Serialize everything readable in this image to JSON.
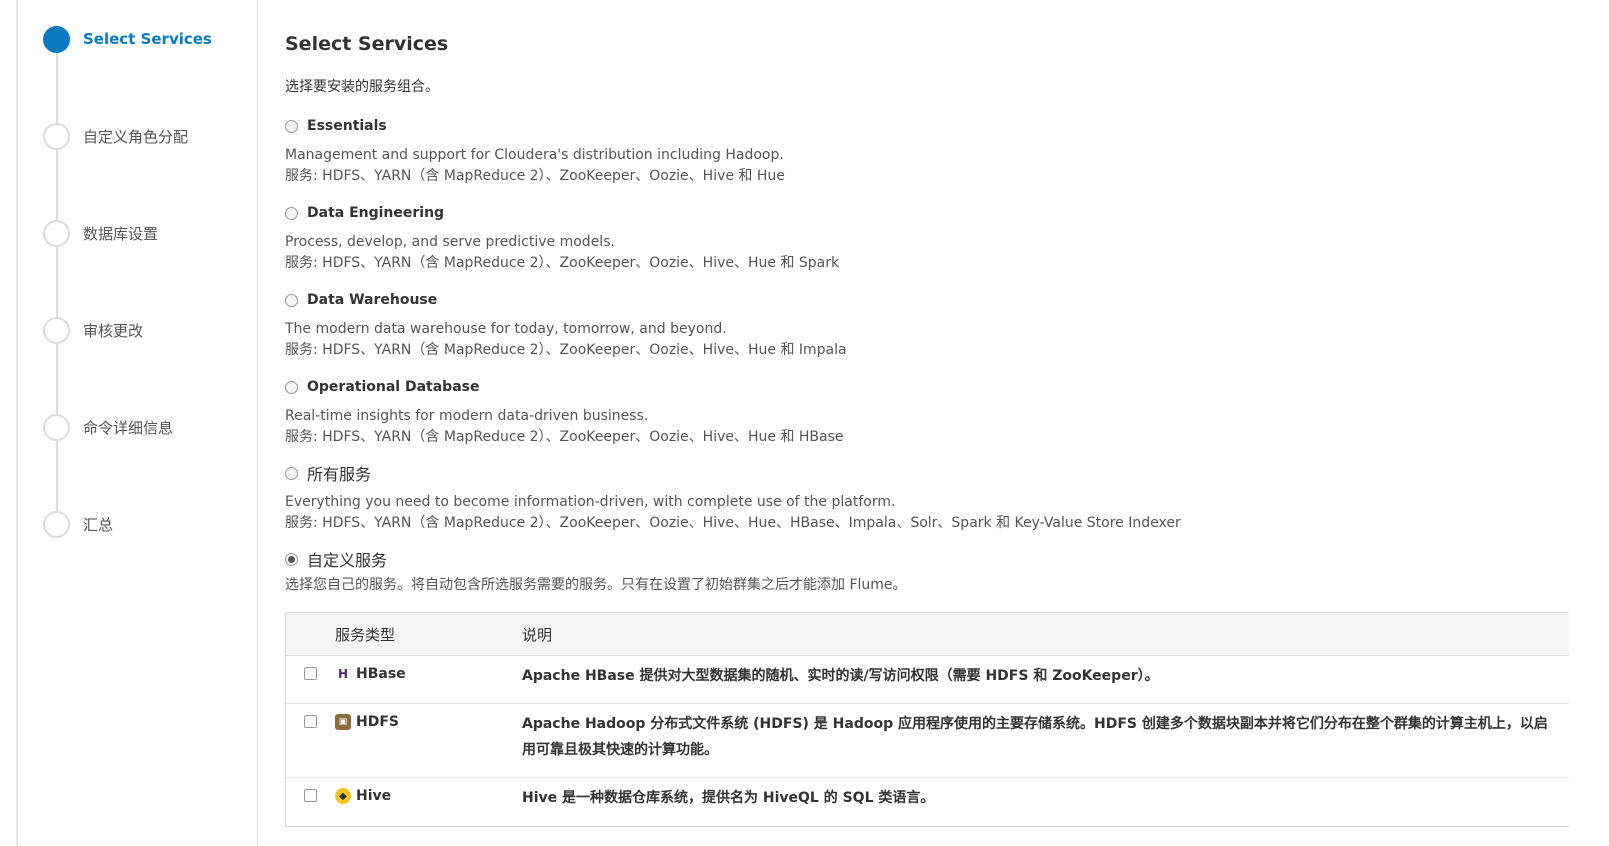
{
  "steps": [
    {
      "label": "Select Services",
      "active": true
    },
    {
      "label": "自定义角色分配",
      "active": false
    },
    {
      "label": "数据库设置",
      "active": false
    },
    {
      "label": "审核更改",
      "active": false
    },
    {
      "label": "命令详细信息",
      "active": false
    },
    {
      "label": "汇总",
      "active": false
    }
  ],
  "page": {
    "title": "Select Services",
    "subtitle": "选择要安装的服务组合。"
  },
  "options": [
    {
      "name": "Essentials",
      "desc1": "Management and support for Cloudera's distribution including Hadoop.",
      "desc2": "服务: HDFS、YARN（含 MapReduce 2）、ZooKeeper、Oozie、Hive 和 Hue",
      "selected": false
    },
    {
      "name": "Data Engineering",
      "desc1": "Process, develop, and serve predictive models.",
      "desc2": "服务: HDFS、YARN（含 MapReduce 2）、ZooKeeper、Oozie、Hive、Hue 和 Spark",
      "selected": false
    },
    {
      "name": "Data Warehouse",
      "desc1": "The modern data warehouse for today, tomorrow, and beyond.",
      "desc2": "服务: HDFS、YARN（含 MapReduce 2）、ZooKeeper、Oozie、Hive、Hue 和 Impala",
      "selected": false
    },
    {
      "name": "Operational Database",
      "desc1": "Real-time insights for modern data-driven business.",
      "desc2": "服务: HDFS、YARN（含 MapReduce 2）、ZooKeeper、Oozie、Hive、Hue 和 HBase",
      "selected": false
    },
    {
      "name": "所有服务",
      "desc1": "Everything you need to become information-driven, with complete use of the platform.",
      "desc2": "服务: HDFS、YARN（含 MapReduce 2）、ZooKeeper、Oozie、Hive、Hue、HBase、Impala、Solr、Spark 和 Key-Value Store Indexer",
      "selected": false
    },
    {
      "name": "自定义服务",
      "desc1": "选择您自己的服务。将自动包含所选服务需要的服务。只有在设置了初始群集之后才能添加 Flume。",
      "selected": true
    }
  ],
  "table": {
    "col_service": "服务类型",
    "col_desc": "说明",
    "rows": [
      {
        "name": "HBase",
        "icon": "hbase-icon",
        "desc": "Apache HBase 提供对大型数据集的随机、实时的读/写访问权限（需要 HDFS 和 ZooKeeper）。",
        "checked": false
      },
      {
        "name": "HDFS",
        "icon": "hdfs-icon",
        "desc": "Apache Hadoop 分布式文件系统 (HDFS) 是 Hadoop 应用程序使用的主要存储系统。HDFS 创建多个数据块副本并将它们分布在整个群集的计算主机上，以启用可靠且极其快速的计算功能。",
        "checked": false
      },
      {
        "name": "Hive",
        "icon": "hive-icon",
        "desc": "Hive 是一种数据仓库系统，提供名为 HiveQL 的 SQL 类语言。",
        "checked": false
      }
    ]
  },
  "colors": {
    "accent": "#0a7ac1"
  }
}
